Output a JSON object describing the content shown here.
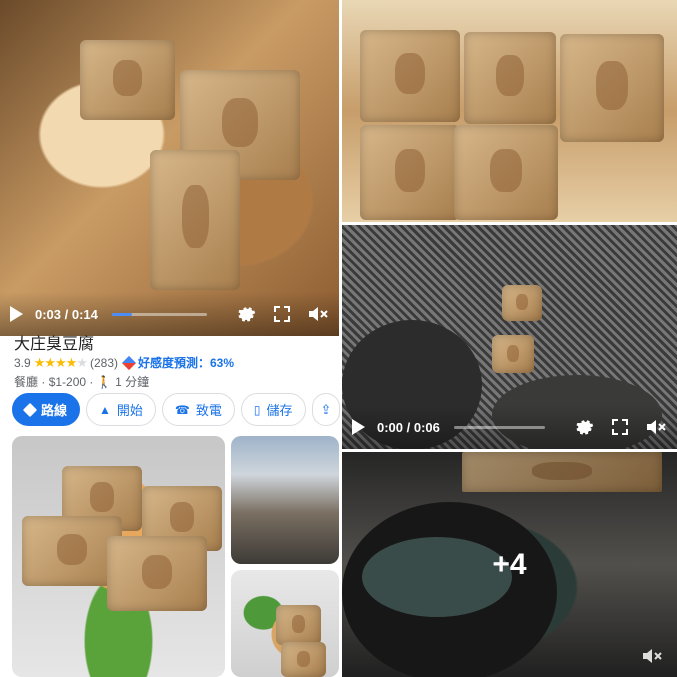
{
  "video1": {
    "time": "0:03 / 0:14",
    "progress": 0.21
  },
  "video2": {
    "time": "0:00 / 0:06",
    "progress": 0.0
  },
  "place": {
    "title": "大庄臭豆腐",
    "rating": "3.9",
    "stars_filled": 4,
    "reviews": "(283)",
    "match_label": "好感度預測：",
    "match_value": "63%",
    "category": "餐廳",
    "price": "$1-200",
    "walk": "1 分鐘"
  },
  "actions": [
    {
      "label": "路線",
      "icon": "directions-icon"
    },
    {
      "label": "開始",
      "icon": "navigation-arrow-icon"
    },
    {
      "label": "致電",
      "icon": "phone-icon"
    },
    {
      "label": "儲存",
      "icon": "bookmark-icon"
    }
  ],
  "more_count": "+4",
  "colors": {
    "accent": "#1a73e8",
    "star": "#fbbc04",
    "progress": "#4c8cf5"
  }
}
